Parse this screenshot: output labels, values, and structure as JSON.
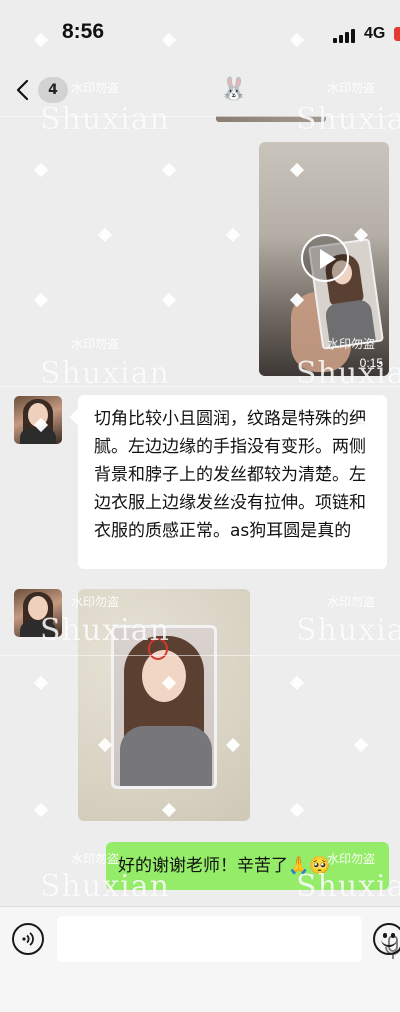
{
  "status_bar": {
    "time": "8:56",
    "network": "4G"
  },
  "nav": {
    "unread_count": "4",
    "contact_icon": "bunny-avatar-icon"
  },
  "messages": {
    "video": {
      "duration": "0:15"
    },
    "text_reply": "切角比较小且圆润，纹路是特殊的细腻。左边边缘的手指没有变形。两侧背景和脖子上的发丝都较为清楚。左边衣服上边缘发丝没有拉伸。项链和衣服的质感正常。as狗耳圆是真的",
    "my_reply": "好的谢谢老师！辛苦了🙏🥺"
  },
  "watermark": {
    "small": "水印勿盗",
    "big": "Shuxian"
  },
  "colors": {
    "background": "#ededed",
    "my_bubble": "#95ec69",
    "other_bubble": "#ffffff",
    "battery": "#e53935"
  }
}
